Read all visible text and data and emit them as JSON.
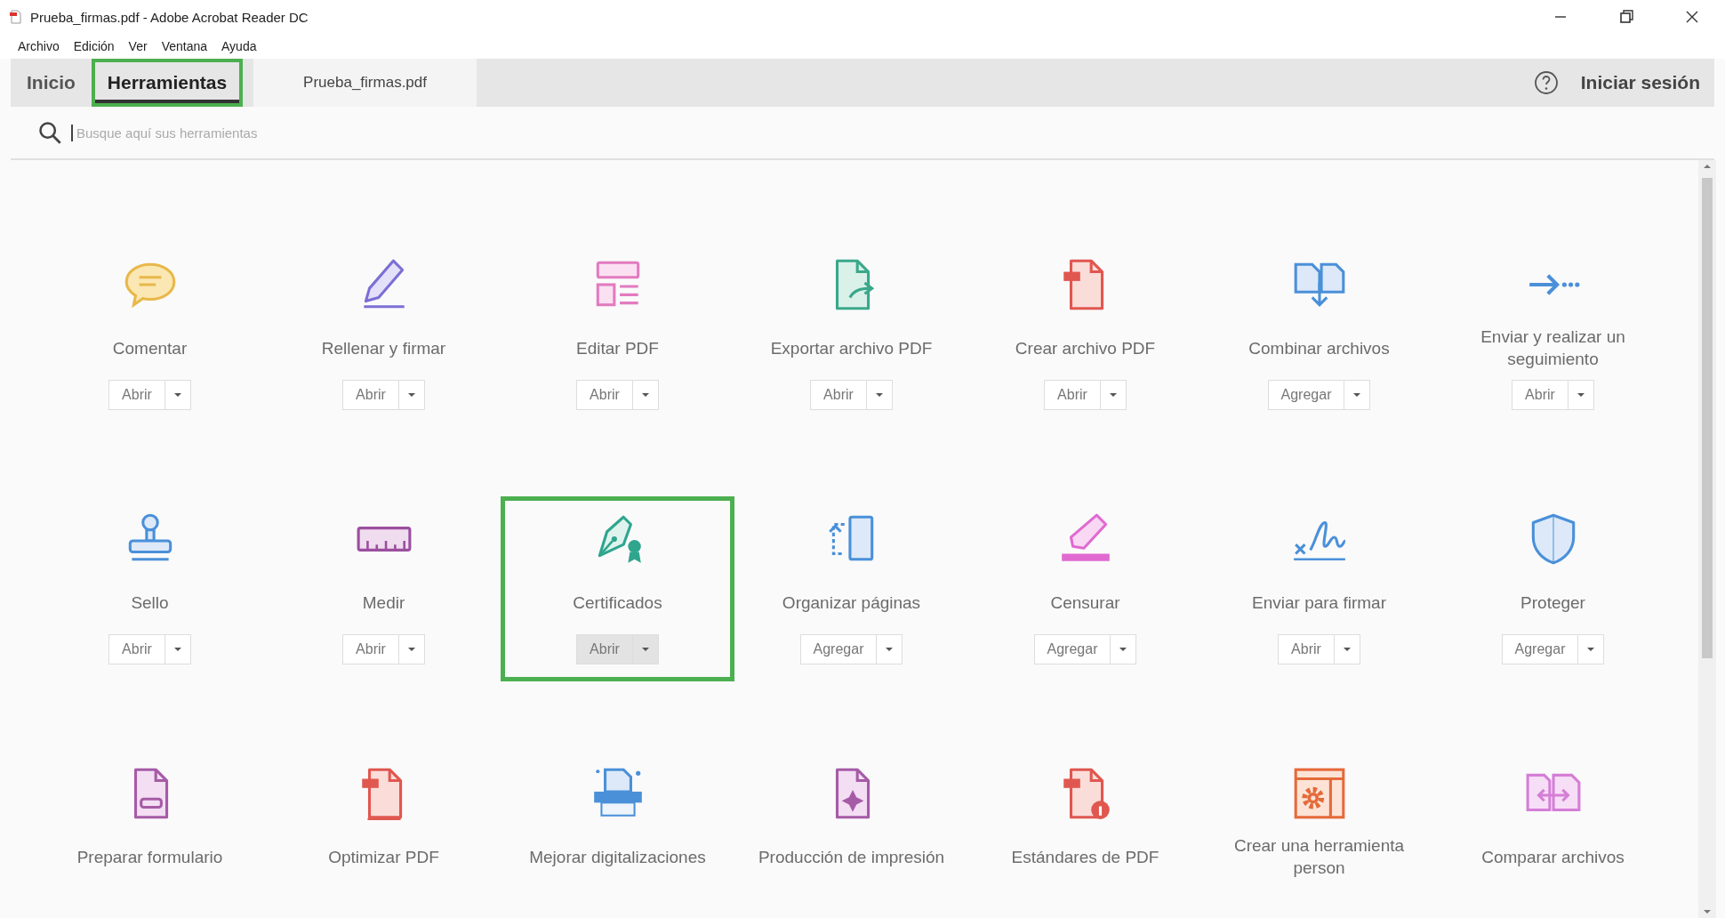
{
  "window": {
    "title": "Prueba_firmas.pdf - Adobe Acrobat Reader DC"
  },
  "menu": [
    "Archivo",
    "Edición",
    "Ver",
    "Ventana",
    "Ayuda"
  ],
  "tabs": [
    {
      "label": "Inicio",
      "kind": "nav",
      "selected": false,
      "highlighted": false
    },
    {
      "label": "Herramientas",
      "kind": "nav",
      "selected": true,
      "highlighted": true
    },
    {
      "label": "Prueba_firmas.pdf",
      "kind": "document",
      "selected": false,
      "highlighted": false
    }
  ],
  "sign_in": "Iniciar sesión",
  "search": {
    "placeholder": "Busque aquí sus herramientas"
  },
  "tools": [
    {
      "label": "Comentar",
      "button": "Abrir",
      "highlighted": false
    },
    {
      "label": "Rellenar y firmar",
      "button": "Abrir",
      "highlighted": false
    },
    {
      "label": "Editar PDF",
      "button": "Abrir",
      "highlighted": false
    },
    {
      "label": "Exportar archivo PDF",
      "button": "Abrir",
      "highlighted": false
    },
    {
      "label": "Crear archivo PDF",
      "button": "Abrir",
      "highlighted": false
    },
    {
      "label": "Combinar archivos",
      "button": "Agregar",
      "highlighted": false
    },
    {
      "label": "Enviar y realizar un seguimiento",
      "button": "Abrir",
      "highlighted": false
    },
    {
      "label": "Sello",
      "button": "Abrir",
      "highlighted": false
    },
    {
      "label": "Medir",
      "button": "Abrir",
      "highlighted": false
    },
    {
      "label": "Certificados",
      "button": "Abrir",
      "highlighted": true
    },
    {
      "label": "Organizar páginas",
      "button": "Agregar",
      "highlighted": false
    },
    {
      "label": "Censurar",
      "button": "Agregar",
      "highlighted": false
    },
    {
      "label": "Enviar para firmar",
      "button": "Abrir",
      "highlighted": false
    },
    {
      "label": "Proteger",
      "button": "Agregar",
      "highlighted": false
    },
    {
      "label": "Preparar formulario",
      "highlighted": false
    },
    {
      "label": "Optimizar PDF",
      "highlighted": false
    },
    {
      "label": "Mejorar digitalizaciones",
      "highlighted": false
    },
    {
      "label": "Producción de impresión",
      "highlighted": false
    },
    {
      "label": "Estándares de PDF",
      "highlighted": false
    },
    {
      "label": "Crear una herramienta person",
      "highlighted": false
    },
    {
      "label": "Comparar archivos",
      "highlighted": false
    }
  ]
}
